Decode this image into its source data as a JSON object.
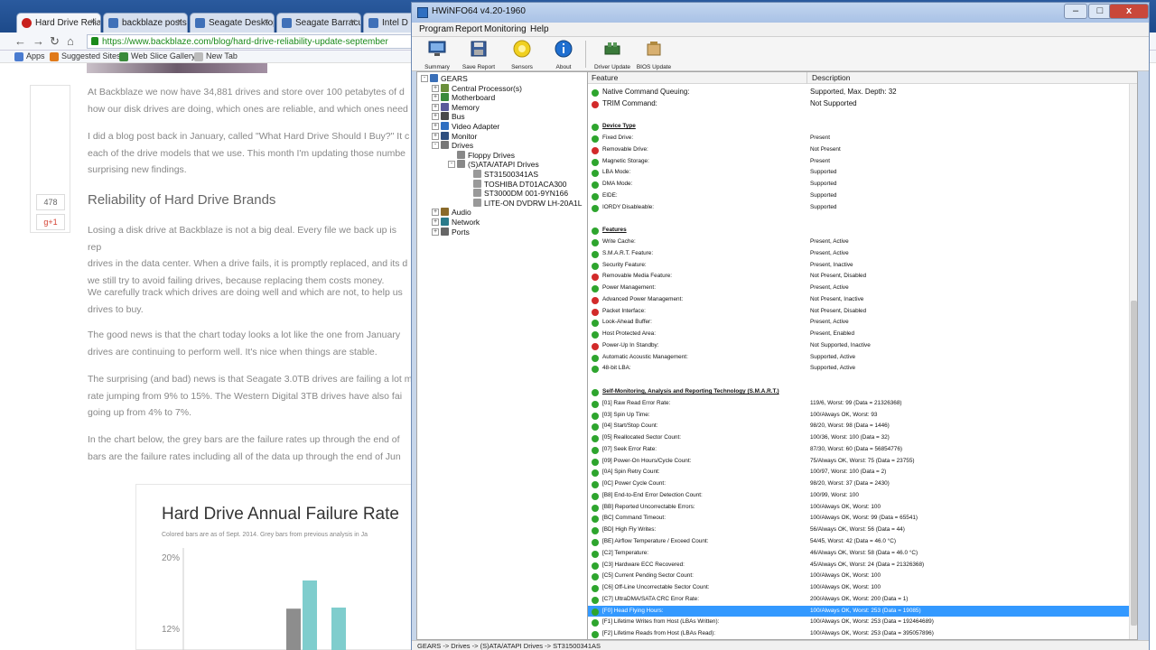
{
  "browser": {
    "tabs": [
      {
        "label": "Hard Drive Reliab",
        "active": true
      },
      {
        "label": "backblaze posts",
        "active": false
      },
      {
        "label": "Seagate Desktop",
        "active": false
      },
      {
        "label": "Seagate Barracu",
        "active": false
      },
      {
        "label": "Intel D",
        "active": false
      }
    ],
    "url": "https://www.backblaze.com/blog/hard-drive-reliability-update-september",
    "bookmarks": [
      "Apps",
      "Suggested Sites",
      "Web Slice Gallery",
      "New Tab"
    ],
    "share_counts": [
      "478",
      "g+1"
    ],
    "paragraphs": [
      "At Backblaze we now have 34,881 drives and store over 100 petabytes of d\nhow our disk drives are doing, which ones are reliable, and which ones need",
      "I did a blog post back in January, called \"What Hard Drive Should I Buy?\" It c\neach of the drive models that we use. This month I'm updating those numbe\nsurprising new findings.",
      "Reliability of Hard Drive Brands",
      "Losing a disk drive at Backblaze is not a big deal. Every file we back up is rep\ndrives in the data center. When a drive fails, it is promptly replaced, and its d\nwe still try to avoid failing drives, because replacing them costs money.",
      "We carefully track which drives are doing well and which are not, to help us\ndrives to buy.",
      "The good news is that the chart today looks a lot like the one from January\ndrives are continuing to perform well. It's nice when things are stable.",
      "The surprising (and bad) news is that Seagate 3.0TB drives are failing a lot m\nrate jumping from 9% to 15%. The Western Digital 3TB drives have also fai\ngoing up from 4% to 7%.",
      "In the chart below, the grey bars are the failure rates up through the end of\nbars are the failure rates including all of the data up through the end of Jun"
    ],
    "chart": {
      "title": "Hard Drive Annual Failure Rate",
      "subtitle": "Colored bars are as of Sept. 2014. Grey bars from previous analysis in Ja",
      "tick_labels": [
        "20%",
        "12%"
      ]
    }
  },
  "chart_data": {
    "type": "bar",
    "title": "Hard Drive Annual Failure Rate",
    "subtitle": "Colored bars are as of Sept. 2014. Grey bars from previous analysis in Ja",
    "y_ticks": [
      "20%",
      "12%"
    ],
    "ylim": [
      0,
      20
    ],
    "grid": false,
    "series": [
      {
        "values": [
          9
        ]
      },
      {
        "values": [
          15
        ]
      }
    ]
  },
  "hwinfo": {
    "title": "HWiNFO64 v4.20-1960",
    "window_buttons": [
      "–",
      "□",
      "x"
    ],
    "menu": [
      "Program",
      "Report",
      "Monitoring",
      "Help"
    ],
    "toolbar": [
      {
        "label": "Summary",
        "icon": "monitor-icon"
      },
      {
        "label": "Save Report",
        "icon": "floppy-disk-icon"
      },
      {
        "label": "Sensors",
        "icon": "sensor-icon"
      },
      {
        "label": "About",
        "icon": "info-icon"
      },
      {
        "label": "Driver Update",
        "icon": "driver-update-icon"
      },
      {
        "label": "BIOS Update",
        "icon": "bios-update-icon"
      }
    ],
    "tree": [
      {
        "label": "GEARS",
        "level": 0,
        "exp": "-",
        "icon": "#3a6fb8"
      },
      {
        "label": "Central Processor(s)",
        "level": 1,
        "exp": "+",
        "icon": "#6a8f3a"
      },
      {
        "label": "Motherboard",
        "level": 1,
        "exp": "+",
        "icon": "#3a8a3a"
      },
      {
        "label": "Memory",
        "level": 1,
        "exp": "+",
        "icon": "#5a5a9a"
      },
      {
        "label": "Bus",
        "level": 1,
        "exp": "+",
        "icon": "#4a4a4a"
      },
      {
        "label": "Video Adapter",
        "level": 1,
        "exp": "+",
        "icon": "#2f6fc1"
      },
      {
        "label": "Monitor",
        "level": 1,
        "exp": "+",
        "icon": "#2f4f7f"
      },
      {
        "label": "Drives",
        "level": 1,
        "exp": "-",
        "icon": "#777777"
      },
      {
        "label": "Floppy Drives",
        "level": 2,
        "exp": "",
        "icon": "#888888"
      },
      {
        "label": "(S)ATA/ATAPI Drives",
        "level": 2,
        "exp": "-",
        "icon": "#888888"
      },
      {
        "label": "ST31500341AS",
        "level": 3,
        "exp": "",
        "icon": "#999999"
      },
      {
        "label": "TOSHIBA DT01ACA300",
        "level": 3,
        "exp": "",
        "icon": "#999999"
      },
      {
        "label": "ST3000DM 001-9YN166",
        "level": 3,
        "exp": "",
        "icon": "#999999"
      },
      {
        "label": "LITE-ON DVDRW LH-20A1L",
        "level": 3,
        "exp": "",
        "icon": "#999999"
      },
      {
        "label": "Audio",
        "level": 1,
        "exp": "+",
        "icon": "#8a6a2a"
      },
      {
        "label": "Network",
        "level": 1,
        "exp": "+",
        "icon": "#2a7a8a"
      },
      {
        "label": "Ports",
        "level": 1,
        "exp": "+",
        "icon": "#666666"
      }
    ],
    "columns": [
      "Feature",
      "Description"
    ],
    "rows": [
      {
        "status": "g",
        "feature": "Native Command Queuing:",
        "desc": "Supported, Max. Depth: 32",
        "big": true
      },
      {
        "status": "r",
        "feature": "TRIM Command:",
        "desc": "Not Supported",
        "big": true
      },
      {
        "status": "",
        "feature": "",
        "desc": ""
      },
      {
        "status": "g",
        "feature": "Device Type",
        "desc": "",
        "section": true
      },
      {
        "status": "g",
        "feature": "Fixed Drive:",
        "desc": "Present"
      },
      {
        "status": "r",
        "feature": "Removable Drive:",
        "desc": "Not Present"
      },
      {
        "status": "g",
        "feature": "Magnetic Storage:",
        "desc": "Present"
      },
      {
        "status": "g",
        "feature": "LBA Mode:",
        "desc": "Supported"
      },
      {
        "status": "g",
        "feature": "DMA Mode:",
        "desc": "Supported"
      },
      {
        "status": "g",
        "feature": "EIDE:",
        "desc": "Supported"
      },
      {
        "status": "g",
        "feature": "IORDY Disableable:",
        "desc": "Supported"
      },
      {
        "status": "",
        "feature": "",
        "desc": ""
      },
      {
        "status": "g",
        "feature": "Features",
        "desc": "",
        "section": true
      },
      {
        "status": "g",
        "feature": "Write Cache:",
        "desc": "Present, Active"
      },
      {
        "status": "g",
        "feature": "S.M.A.R.T. Feature:",
        "desc": "Present, Active"
      },
      {
        "status": "g",
        "feature": "Security Feature:",
        "desc": "Present, Inactive"
      },
      {
        "status": "r",
        "feature": "Removable Media Feature:",
        "desc": "Not Present, Disabled"
      },
      {
        "status": "g",
        "feature": "Power Management:",
        "desc": "Present, Active"
      },
      {
        "status": "r",
        "feature": "Advanced Power Management:",
        "desc": "Not Present, Inactive"
      },
      {
        "status": "r",
        "feature": "Packet Interface:",
        "desc": "Not Present, Disabled"
      },
      {
        "status": "g",
        "feature": "Look-Ahead Buffer:",
        "desc": "Present, Active"
      },
      {
        "status": "g",
        "feature": "Host Protected Area:",
        "desc": "Present, Enabled"
      },
      {
        "status": "r",
        "feature": "Power-Up In Standby:",
        "desc": "Not Supported, Inactive"
      },
      {
        "status": "g",
        "feature": "Automatic Acoustic Management:",
        "desc": "Supported, Active"
      },
      {
        "status": "g",
        "feature": "48-bit LBA:",
        "desc": "Supported, Active"
      },
      {
        "status": "",
        "feature": "",
        "desc": ""
      },
      {
        "status": "g",
        "feature": "Self-Monitoring, Analysis and Reporting Technology (S.M.A.R.T.)",
        "desc": "",
        "section": true
      },
      {
        "status": "g",
        "feature": "[01] Raw Read Error Rate:",
        "desc": "119/6, Worst: 99 (Data = 21326368)"
      },
      {
        "status": "g",
        "feature": "[03] Spin Up Time:",
        "desc": "100/Always OK, Worst: 93"
      },
      {
        "status": "g",
        "feature": "[04] Start/Stop Count:",
        "desc": "98/20, Worst: 98 (Data = 1446)"
      },
      {
        "status": "g",
        "feature": "[05] Reallocated Sector Count:",
        "desc": "100/36, Worst: 100 (Data = 32)"
      },
      {
        "status": "g",
        "feature": "[07] Seek Error Rate:",
        "desc": "87/30, Worst: 60 (Data = 56854776)"
      },
      {
        "status": "g",
        "feature": "[09] Power-On Hours/Cycle Count:",
        "desc": "75/Always OK, Worst: 75 (Data = 23755)"
      },
      {
        "status": "g",
        "feature": "[0A] Spin Retry Count:",
        "desc": "100/97, Worst: 100 (Data = 2)"
      },
      {
        "status": "g",
        "feature": "[0C] Power Cycle Count:",
        "desc": "98/20, Worst: 37 (Data = 2430)"
      },
      {
        "status": "g",
        "feature": "[B8] End-to-End Error Detection Count:",
        "desc": "100/99, Worst: 100"
      },
      {
        "status": "g",
        "feature": "[BB] Reported Uncorrectable Errors:",
        "desc": "100/Always OK, Worst: 100"
      },
      {
        "status": "g",
        "feature": "[BC] Command Timeout:",
        "desc": "100/Always OK, Worst: 99 (Data = 65541)"
      },
      {
        "status": "g",
        "feature": "[BD] High Fly Writes:",
        "desc": "56/Always OK, Worst: 56 (Data = 44)"
      },
      {
        "status": "g",
        "feature": "[BE] Airflow Temperature / Exceed Count:",
        "desc": "54/45, Worst: 42 (Data = 46.0 °C)"
      },
      {
        "status": "g",
        "feature": "[C2] Temperature:",
        "desc": "46/Always OK, Worst: 58 (Data = 46.0 °C)"
      },
      {
        "status": "g",
        "feature": "[C3] Hardware ECC Recovered:",
        "desc": "45/Always OK, Worst: 24 (Data = 21326368)"
      },
      {
        "status": "g",
        "feature": "[C5] Current Pending Sector Count:",
        "desc": "100/Always OK, Worst: 100"
      },
      {
        "status": "g",
        "feature": "[C6] Off-Line Uncorrectable Sector Count:",
        "desc": "100/Always OK, Worst: 100"
      },
      {
        "status": "g",
        "feature": "[C7] UltraDMA/SATA CRC Error Rate:",
        "desc": "200/Always OK, Worst: 200 (Data = 1)"
      },
      {
        "status": "g",
        "feature": "[F0] Head Flying Hours:",
        "desc": "100/Always OK, Worst: 253 (Data = 19085)",
        "selected": true
      },
      {
        "status": "g",
        "feature": "[F1] Lifetime Writes from Host (LBAs Written):",
        "desc": "100/Always OK, Worst: 253 (Data = 192464689)"
      },
      {
        "status": "g",
        "feature": "[F2] Lifetime Reads from Host (LBAs Read):",
        "desc": "100/Always OK, Worst: 253 (Data = 395057896)"
      }
    ],
    "status": "GEARS -> Drives -> (S)ATA/ATAPI Drives -> ST31500341AS"
  }
}
